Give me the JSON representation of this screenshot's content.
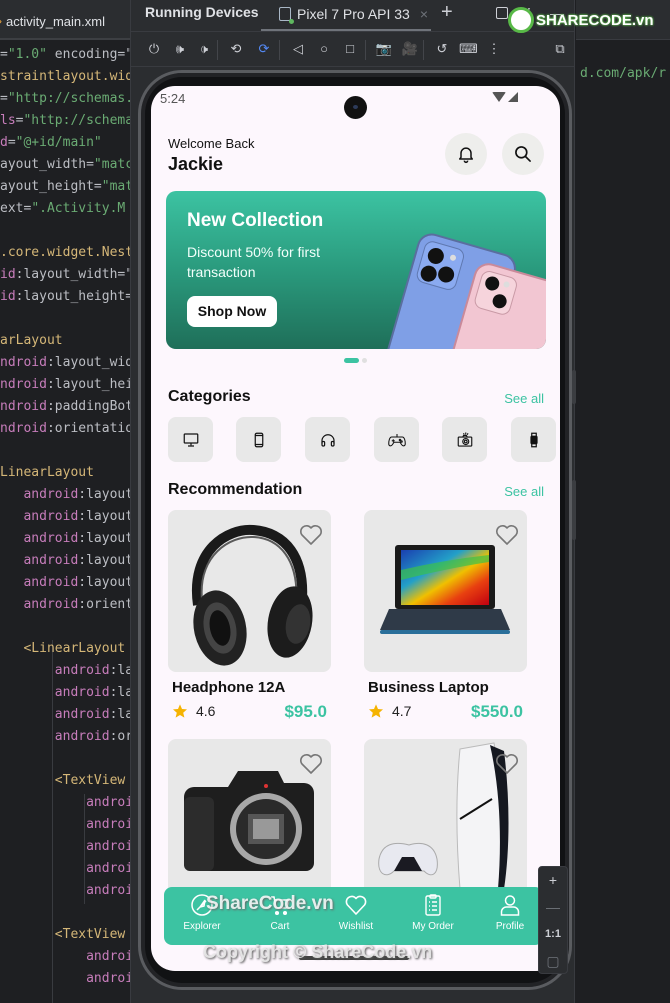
{
  "editor": {
    "tab_label": "activity_main.xml",
    "lines": [
      [
        {
          "t": "=",
          "c": "def"
        },
        {
          "t": "\"1.0\"",
          "c": "str"
        },
        {
          "t": " encoding=\"",
          "c": "def"
        }
      ],
      [
        {
          "t": "straintlayout.wid",
          "c": "tag"
        }
      ],
      [
        {
          "t": "=",
          "c": "def"
        },
        {
          "t": "\"http://schemas.",
          "c": "str"
        }
      ],
      [
        {
          "t": "ls",
          "c": "attr"
        },
        {
          "t": "=",
          "c": "def"
        },
        {
          "t": "\"http://schema",
          "c": "str"
        }
      ],
      [
        {
          "t": "d",
          "c": "attr"
        },
        {
          "t": "=",
          "c": "def"
        },
        {
          "t": "\"@+id/main\"",
          "c": "str"
        }
      ],
      [
        {
          "t": "ayout_width=",
          "c": "def"
        },
        {
          "t": "\"matc",
          "c": "str"
        }
      ],
      [
        {
          "t": "ayout_height=",
          "c": "def"
        },
        {
          "t": "\"mat",
          "c": "str"
        }
      ],
      [
        {
          "t": "ext=",
          "c": "def"
        },
        {
          "t": "\".Activity.M",
          "c": "str"
        }
      ],
      [
        {
          "t": "",
          "c": "def"
        }
      ],
      [
        {
          "t": ".core.widget.Nest",
          "c": "tag"
        }
      ],
      [
        {
          "t": "id",
          "c": "attr"
        },
        {
          "t": ":layout_width=\"",
          "c": "def"
        }
      ],
      [
        {
          "t": "id",
          "c": "attr"
        },
        {
          "t": ":layout_height=",
          "c": "def"
        }
      ],
      [
        {
          "t": "",
          "c": "def"
        }
      ],
      [
        {
          "t": "arLayout",
          "c": "tag"
        }
      ],
      [
        {
          "t": "ndroid",
          "c": "attr"
        },
        {
          "t": ":layout_wid",
          "c": "def"
        }
      ],
      [
        {
          "t": "ndroid",
          "c": "attr"
        },
        {
          "t": ":layout_hei",
          "c": "def"
        }
      ],
      [
        {
          "t": "ndroid",
          "c": "attr"
        },
        {
          "t": ":paddingBot",
          "c": "def"
        }
      ],
      [
        {
          "t": "ndroid",
          "c": "attr"
        },
        {
          "t": ":orientatio",
          "c": "def"
        }
      ],
      [
        {
          "t": "",
          "c": "def"
        }
      ],
      [
        {
          "t": "LinearLayout",
          "c": "tag"
        }
      ],
      [
        {
          "t": "   android",
          "c": "attr"
        },
        {
          "t": ":layout",
          "c": "def"
        }
      ],
      [
        {
          "t": "   android",
          "c": "attr"
        },
        {
          "t": ":layout",
          "c": "def"
        }
      ],
      [
        {
          "t": "   android",
          "c": "attr"
        },
        {
          "t": ":layout",
          "c": "def"
        }
      ],
      [
        {
          "t": "   android",
          "c": "attr"
        },
        {
          "t": ":layout",
          "c": "def"
        }
      ],
      [
        {
          "t": "   android",
          "c": "attr"
        },
        {
          "t": ":layout",
          "c": "def"
        }
      ],
      [
        {
          "t": "   android",
          "c": "attr"
        },
        {
          "t": ":orient",
          "c": "def"
        }
      ],
      [
        {
          "t": "",
          "c": "def"
        }
      ],
      [
        {
          "t": "   <LinearLayout",
          "c": "tag"
        }
      ],
      [
        {
          "t": "       android",
          "c": "attr"
        },
        {
          "t": ":la",
          "c": "def"
        }
      ],
      [
        {
          "t": "       android",
          "c": "attr"
        },
        {
          "t": ":la",
          "c": "def"
        }
      ],
      [
        {
          "t": "       android",
          "c": "attr"
        },
        {
          "t": ":la",
          "c": "def"
        }
      ],
      [
        {
          "t": "       android",
          "c": "attr"
        },
        {
          "t": ":or",
          "c": "def"
        }
      ],
      [
        {
          "t": "",
          "c": "def"
        }
      ],
      [
        {
          "t": "       <TextView",
          "c": "tag"
        }
      ],
      [
        {
          "t": "           androi",
          "c": "attr"
        }
      ],
      [
        {
          "t": "           androi",
          "c": "attr"
        }
      ],
      [
        {
          "t": "           androi",
          "c": "attr"
        }
      ],
      [
        {
          "t": "           androi",
          "c": "attr"
        }
      ],
      [
        {
          "t": "           androi",
          "c": "attr"
        }
      ],
      [
        {
          "t": "",
          "c": "def"
        }
      ],
      [
        {
          "t": "       <TextView",
          "c": "tag"
        }
      ],
      [
        {
          "t": "           androi",
          "c": "attr"
        }
      ],
      [
        {
          "t": "           androi",
          "c": "attr"
        }
      ]
    ],
    "right_snippet": "d.com/apk/r"
  },
  "running_devices": {
    "title": "Running Devices",
    "device_tab": "Pixel 7 Pro API 33",
    "tab_close": "×",
    "add_tab": "+",
    "header_more": "⋮",
    "header_minimize": "—",
    "toolbar": [
      {
        "name": "power-icon",
        "glyph": "⏻"
      },
      {
        "name": "volume-up-icon",
        "glyph": "🕪"
      },
      {
        "name": "volume-down-icon",
        "glyph": "🕩"
      },
      {
        "name": "rotate-left-icon",
        "glyph": "⟲"
      },
      {
        "name": "rotate-right-icon",
        "glyph": "⟳"
      },
      {
        "name": "back-icon",
        "glyph": "◁"
      },
      {
        "name": "home-icon",
        "glyph": "○"
      },
      {
        "name": "overview-icon",
        "glyph": "□"
      },
      {
        "name": "screenshot-icon",
        "glyph": "📷"
      },
      {
        "name": "screen-record-icon",
        "glyph": "🎥"
      },
      {
        "name": "snapshot-icon",
        "glyph": "↺"
      },
      {
        "name": "keyboard-icon",
        "glyph": "⌨"
      },
      {
        "name": "more-icon",
        "glyph": "⋮"
      },
      {
        "name": "device-explorer-icon",
        "glyph": "⧉"
      }
    ],
    "zoom_controls": {
      "zoom_in": "+",
      "zoom_out": "—",
      "actual_size": "1:1",
      "fit": "▢"
    }
  },
  "app": {
    "status_time": "5:24",
    "welcome": "Welcome Back",
    "username": "Jackie",
    "banner": {
      "title": "New Collection",
      "subtitle": "Discount 50% for first transaction",
      "button": "Shop Now",
      "page_count": 2,
      "active_page": 1
    },
    "categories": {
      "title": "Categories",
      "see_all": "See all",
      "items": [
        {
          "name": "computer",
          "icon": "monitor-icon"
        },
        {
          "name": "phone",
          "icon": "smartphone-icon"
        },
        {
          "name": "headphone",
          "icon": "headphones-icon"
        },
        {
          "name": "gaming",
          "icon": "gamepad-icon"
        },
        {
          "name": "camera",
          "icon": "camera-icon"
        },
        {
          "name": "watch",
          "icon": "smartwatch-icon"
        }
      ]
    },
    "recommendation": {
      "title": "Recommendation",
      "see_all": "See all",
      "products": [
        {
          "name": "Headphone 12A",
          "rating": "4.6",
          "price": "$95.0",
          "image": "headphone"
        },
        {
          "name": "Business Laptop",
          "rating": "4.7",
          "price": "$550.0",
          "image": "laptop"
        },
        {
          "name": "",
          "rating": "",
          "price": "",
          "image": "camera"
        },
        {
          "name": "",
          "rating": "",
          "price": "",
          "image": "console"
        }
      ]
    },
    "bottom_nav": [
      {
        "label": "Explorer",
        "icon": "compass-icon"
      },
      {
        "label": "Cart",
        "icon": "cart-icon"
      },
      {
        "label": "Wishlist",
        "icon": "heart-icon"
      },
      {
        "label": "My Order",
        "icon": "order-list-icon"
      },
      {
        "label": "Profile",
        "icon": "profile-icon"
      }
    ]
  },
  "colors": {
    "accent": "#3cc3a2",
    "screen_bg": "#fdf7fd",
    "card_bg": "#e8e8e8",
    "star": "#f5b301"
  },
  "watermark": {
    "logo_text": "SHARECODE.vn",
    "center_text": "ShareCode.vn",
    "copyright": "Copyright © ShareCode.vn"
  }
}
